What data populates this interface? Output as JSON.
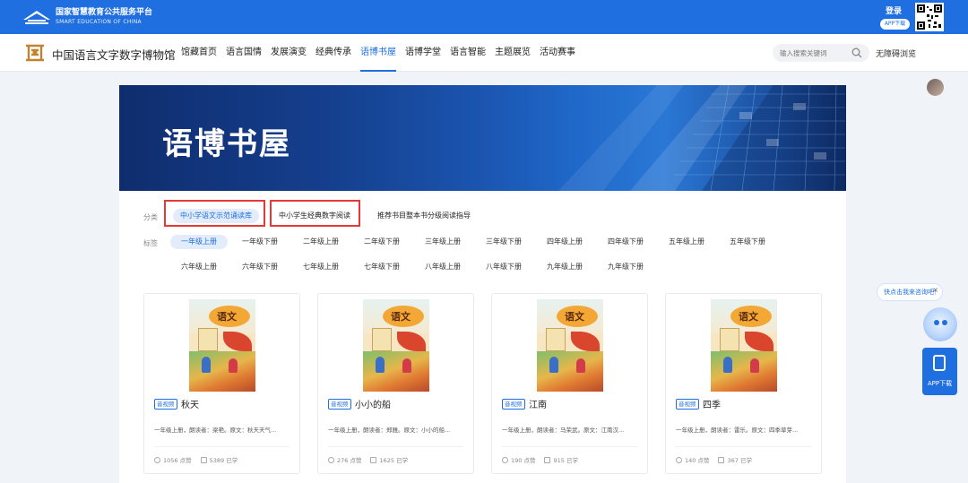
{
  "platform": {
    "name": "国家智慧教育公共服务平台",
    "name_en": "SMART EDUCATION OF CHINA",
    "login": "登录",
    "app_download": "APP下载"
  },
  "museum": {
    "title": "中国语言文字数字博物馆",
    "menu": [
      "馆藏首页",
      "语言国情",
      "发展演变",
      "经典传承",
      "语博书屋",
      "语博学堂",
      "语言智能",
      "主题展览",
      "活动赛事"
    ],
    "active_menu": "语博书屋",
    "search_placeholder": "输入搜索关键词",
    "accessibility": "无障碍浏览"
  },
  "banner": {
    "title": "语博书屋"
  },
  "filters": {
    "category_label": "分类",
    "categories": [
      "中小学语文示范诵读库",
      "中小学生经典数字阅读",
      "推荐书目整本书分级阅读指导"
    ],
    "tag_label": "标签",
    "tags": [
      "一年级上册",
      "一年级下册",
      "二年级上册",
      "二年级下册",
      "三年级上册",
      "三年级下册",
      "四年级上册",
      "四年级下册",
      "五年级上册",
      "五年级下册",
      "六年级上册",
      "六年级下册",
      "七年级上册",
      "七年级下册",
      "八年级上册",
      "八年级下册",
      "九年级上册",
      "九年级下册"
    ],
    "active_tag": "一年级上册"
  },
  "cards": [
    {
      "badge": "音视频",
      "title": "秋天",
      "desc": "一年级上册，朗读者：梁艳。原文：秋天天气...",
      "likes": "1056 点赞",
      "learned": "5389 已学"
    },
    {
      "badge": "音视频",
      "title": "小小的船",
      "desc": "一年级上册，朗读者：郑雅。原文：小小的船...",
      "likes": "276 点赞",
      "learned": "1625 已学"
    },
    {
      "badge": "音视频",
      "title": "江南",
      "desc": "一年级上册，朗读者：马荣武。原文：江南汉...",
      "likes": "190 点赞",
      "learned": "915 已学"
    },
    {
      "badge": "音视频",
      "title": "四季",
      "desc": "一年级上册，朗读者：雷乐。原文：四季草芽...",
      "likes": "140 点赞",
      "learned": "367 已学"
    }
  ],
  "cover_text": "语文",
  "float": {
    "help": "快点击我来咨询吧！",
    "close": "×",
    "app": "APP下载"
  },
  "colors": {
    "primary": "#1f6fe0",
    "highlight_box": "#e53935"
  }
}
